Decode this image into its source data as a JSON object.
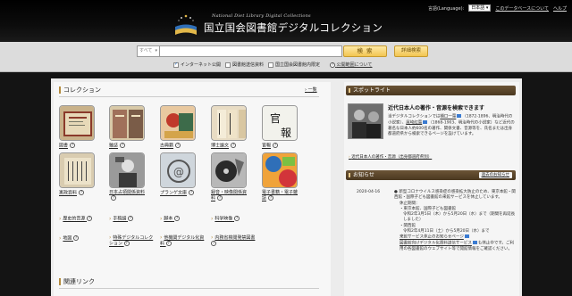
{
  "header": {
    "language_label": "言語(Language):",
    "language_value": "日本語",
    "about_link": "このデータベースについて",
    "help_link": "ヘルプ",
    "logo_en": "National Diet Library Digital Collections",
    "logo_ja": "国立国会図書館デジタルコレクション"
  },
  "search": {
    "scope_value": "すべて",
    "query_value": "",
    "search_button": "検 索",
    "advanced_button": "詳細検索",
    "filters": [
      {
        "label": "インターネット公開",
        "checked": true
      },
      {
        "label": "図書館送信資料",
        "checked": false
      },
      {
        "label": "国立国会図書館内限定",
        "checked": false
      }
    ],
    "public_scope_link": "公開範囲について"
  },
  "collection": {
    "title": "コレクション",
    "more_link": "一覧",
    "tiles": [
      {
        "label": "図書"
      },
      {
        "label": "雑誌"
      },
      {
        "label": "古典籍"
      },
      {
        "label": "博士論文"
      },
      {
        "label": "官報"
      },
      {
        "label": "憲政資料"
      },
      {
        "label": "日本占領関係資料"
      },
      {
        "label": "プランゲ文庫"
      },
      {
        "label": "録音・映像関係資料"
      },
      {
        "label": "電子書籍・電子雑誌"
      }
    ],
    "links": [
      {
        "label": "歴史的音源"
      },
      {
        "label": "手稿譜"
      },
      {
        "label": "脚本"
      },
      {
        "label": "科学映像"
      },
      {
        "label": "地図"
      },
      {
        "label": "特殊デジタルコレクション"
      },
      {
        "label": "他機関デジタル化資料"
      },
      {
        "label": "内務省検閲発禁図書"
      }
    ]
  },
  "related": {
    "title": "関連リンク"
  },
  "spotlight": {
    "title": "スポットライト",
    "headline": "近代日本人の著作・音源を検索できます",
    "body_1": "当デジタルコレクションでは",
    "name_1": "樋口一葉",
    "body_2": "（1872-1896、明治時代の小説家）、",
    "name_2": "尾崎紅葉",
    "body_3": "（1868-1903、明治時代の小説家）など近代の著名な日本人約600名の著作、関係文書、音源等を、氏名または出身都道府県から検索できるページを設けています。",
    "more_link": "近代日本人の著作・音源（出身都道府県別）"
  },
  "notices": {
    "title": "お知らせ",
    "past_link": "過去のお知らせ",
    "items": [
      {
        "date": "2020-04-16",
        "text_1": "新型コロナウイルス感染症の感染拡大防止のため、東京本館・関西館・国際子ども図書館の来館サービスを休止しています。",
        "text_2": "休止期間：",
        "text_3": "・東京本館、国際子ども図書館",
        "text_4": "令和2年3月5日（木）から5月20日（水）まで（期間を再延長しました）",
        "text_5": "・関西館",
        "text_6": "令和2年4月11日（土）から5月20日（水）まで",
        "link_1": "来館サービス休止のお知らせページ",
        "text_7": "図書館向けデジタル化資料送信サービス",
        "text_8": "も休止中です。ご利用の各図書館のウェブサイト等で開館情報をご確認ください。"
      }
    ]
  },
  "colors": {
    "accent": "#b48b3e",
    "panel_header": "#4a3820",
    "button_gold": "#f3c550",
    "link_marker": "#3b7bd1"
  }
}
